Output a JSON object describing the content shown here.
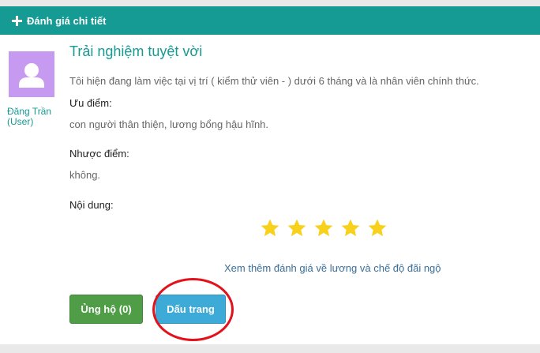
{
  "header": {
    "title": "Đánh giá chi tiết",
    "icon": "plus-icon"
  },
  "review": {
    "author": "Đăng Trần (User)",
    "title": "Trải nghiệm tuyệt vời",
    "intro": "Tôi hiện đang làm việc tại vị trí ( kiểm thử viên - ) dưới 6 tháng và là nhân viên chính thức.",
    "pros_label": "Ưu điểm:",
    "pros_text": "con người thân thiện, lương bổng hậu hĩnh.",
    "cons_label": "Nhược điểm:",
    "cons_text": "không.",
    "content_label": "Nội dung:",
    "rating": 5,
    "rating_max": 5,
    "salary_link": "Xem thêm đánh giá về lương và chế độ đãi ngộ"
  },
  "actions": {
    "support_label": "Ủng hộ (0)",
    "bookmark_label": "Dấu trang"
  },
  "colors": {
    "header": "#159a94",
    "accent_text": "#159a94",
    "star": "#f8d11c",
    "support_button": "#4f9d47",
    "bookmark_button": "#3eaad8",
    "annotation_circle": "#e4101a"
  }
}
